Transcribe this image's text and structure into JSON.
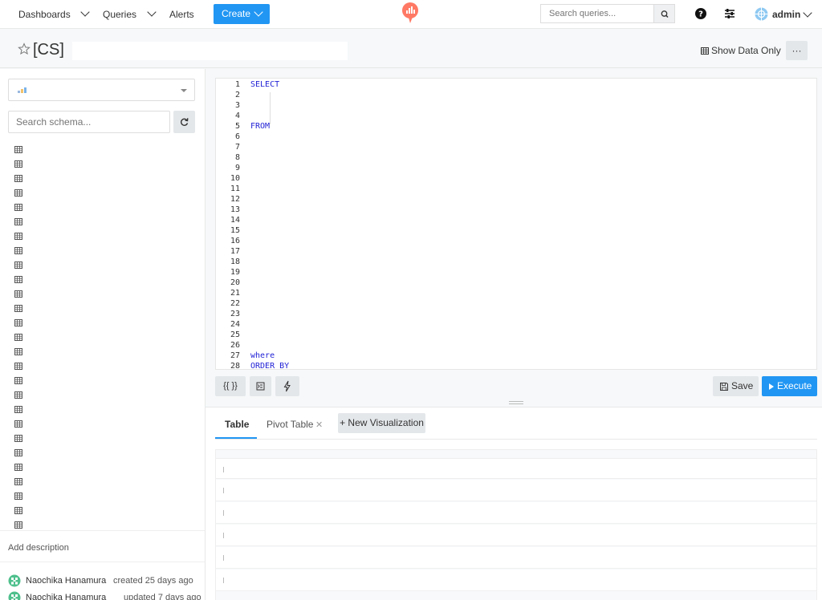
{
  "nav": {
    "dashboards": "Dashboards",
    "queries": "Queries",
    "alerts": "Alerts",
    "create": "Create",
    "search_placeholder": "Search queries...",
    "user": "admin"
  },
  "query": {
    "title": "[CS]",
    "show_data_only": "Show Data Only",
    "more": "···"
  },
  "sidebar": {
    "schema_search_placeholder": "Search schema...",
    "add_description": "Add description",
    "meta": [
      {
        "user": "Naochika Hanamura",
        "action": "created 25 days ago"
      },
      {
        "user": "Naochika Hanamura",
        "action": "updated 7 days ago"
      }
    ]
  },
  "editor": {
    "line_numbers": [
      "1",
      "2",
      "3",
      "4",
      "5",
      "6",
      "7",
      "8",
      "9",
      "10",
      "11",
      "12",
      "13",
      "14",
      "15",
      "16",
      "17",
      "18",
      "19",
      "20",
      "21",
      "22",
      "23",
      "24",
      "25",
      "26",
      "27",
      "28"
    ],
    "keywords": [
      {
        "line": 1,
        "text": "SELECT"
      },
      {
        "line": 5,
        "text": "FROM"
      },
      {
        "line": 27,
        "text": "where"
      },
      {
        "line": 28,
        "text": "ORDER BY"
      }
    ],
    "toolbar": {
      "params": "{{ }}",
      "save": "Save",
      "execute": "Execute"
    }
  },
  "results": {
    "tabs": [
      "Table",
      "Pivot Table"
    ],
    "new_visualization": "+ New Visualization"
  },
  "colors": {
    "primary": "#2196f3",
    "logo": "#ff7964",
    "keyword": "#1f1fd6",
    "avatar": "#4fc08d"
  }
}
